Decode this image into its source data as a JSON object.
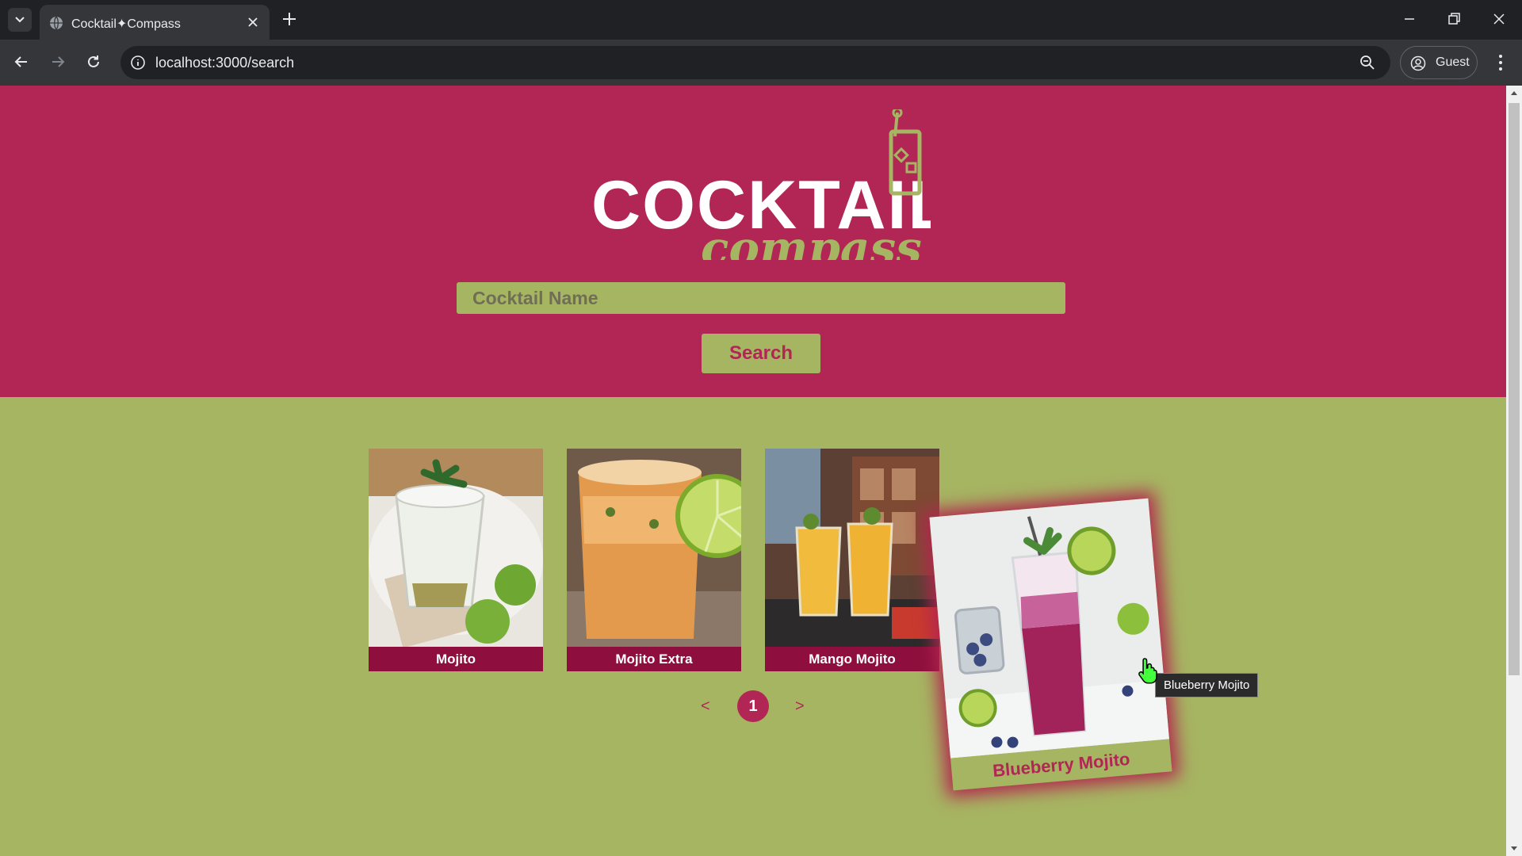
{
  "browser": {
    "tab_title": "Cocktail✦Compass",
    "url": "localhost:3000/search",
    "profile_label": "Guest"
  },
  "page": {
    "logo_text_top": "COCKTAIL",
    "logo_text_bottom": "compass",
    "search": {
      "placeholder": "Cocktail Name",
      "value": "",
      "button_label": "Search"
    },
    "results": [
      {
        "name": "Mojito"
      },
      {
        "name": "Mojito Extra"
      },
      {
        "name": "Mango Mojito"
      },
      {
        "name": "Blueberry Mojito"
      }
    ],
    "pagination": {
      "prev": "<",
      "current_page": "1",
      "next": ">"
    },
    "tooltip": "Blueberry Mojito"
  },
  "colors": {
    "primary": "#b22655",
    "accent": "#a6b562",
    "caption_bg": "#8e0f3d"
  }
}
